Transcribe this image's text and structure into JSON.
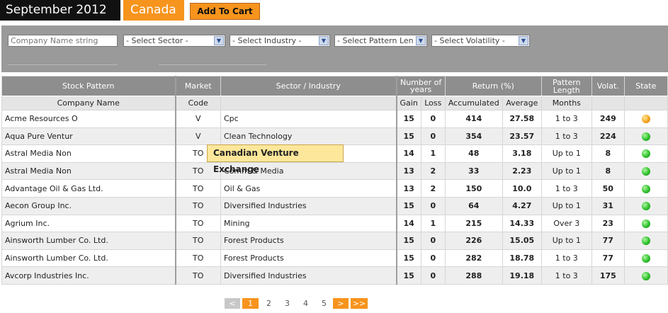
{
  "header": {
    "month": "September 2012",
    "country": "Canada",
    "add_to_cart": "Add To Cart"
  },
  "filters": {
    "company_placeholder": "Company Name string",
    "sector": "- Select Sector -",
    "industry": "- Select Industry -",
    "pattern_length": "- Select Pattern Len",
    "volatility": "- Select Volatility -"
  },
  "table": {
    "group_headers": {
      "stock_pattern": "Stock Pattern",
      "market": "Market",
      "sector_industry": "Sector / Industry",
      "number_of_years": "Number of years",
      "return": "Return (%)",
      "pattern_length": "Pattern Length",
      "volat": "Volat.",
      "state": "State"
    },
    "sub_headers": {
      "company_name": "Company Name",
      "code": "Code",
      "gain": "Gain",
      "loss": "Loss",
      "accumulated": "Accumulated",
      "average": "Average",
      "months": "Months"
    },
    "rows": [
      {
        "company": "Acme Resources O",
        "code": "V",
        "sector": "Cpc",
        "gain": "15",
        "loss": "0",
        "accumulated": "414",
        "average": "27.58",
        "length": "1 to 3",
        "volat": "249",
        "state": "orange"
      },
      {
        "company": "Aqua Pure Ventur",
        "code": "V",
        "sector": "Clean Technology",
        "gain": "15",
        "loss": "0",
        "accumulated": "354",
        "average": "23.57",
        "length": "1 to 3",
        "volat": "224",
        "state": "green"
      },
      {
        "company": "Astral Media Non",
        "code": "TO",
        "sector": "",
        "gain": "14",
        "loss": "1",
        "accumulated": "48",
        "average": "3.18",
        "length": "Up to 1",
        "volat": "8",
        "state": "green"
      },
      {
        "company": "Astral Media Non",
        "code": "TO",
        "sector": "Comm & Media",
        "gain": "13",
        "loss": "2",
        "accumulated": "33",
        "average": "2.23",
        "length": "Up to 1",
        "volat": "8",
        "state": "green"
      },
      {
        "company": "Advantage Oil & Gas Ltd.",
        "code": "TO",
        "sector": "Oil & Gas",
        "gain": "13",
        "loss": "2",
        "accumulated": "150",
        "average": "10.0",
        "length": "1 to 3",
        "volat": "50",
        "state": "green"
      },
      {
        "company": "Aecon Group Inc.",
        "code": "TO",
        "sector": "Diversified Industries",
        "gain": "15",
        "loss": "0",
        "accumulated": "64",
        "average": "4.27",
        "length": "Up to 1",
        "volat": "31",
        "state": "green"
      },
      {
        "company": "Agrium Inc.",
        "code": "TO",
        "sector": "Mining",
        "gain": "14",
        "loss": "1",
        "accumulated": "215",
        "average": "14.33",
        "length": "Over 3",
        "volat": "23",
        "state": "green"
      },
      {
        "company": "Ainsworth Lumber Co. Ltd.",
        "code": "TO",
        "sector": "Forest Products",
        "gain": "15",
        "loss": "0",
        "accumulated": "226",
        "average": "15.05",
        "length": "Up to 1",
        "volat": "77",
        "state": "green"
      },
      {
        "company": "Ainsworth Lumber Co. Ltd.",
        "code": "TO",
        "sector": "Forest Products",
        "gain": "15",
        "loss": "0",
        "accumulated": "282",
        "average": "18.78",
        "length": "1 to 3",
        "volat": "77",
        "state": "green"
      },
      {
        "company": "Avcorp Industries Inc.",
        "code": "TO",
        "sector": "Diversified Industries",
        "gain": "15",
        "loss": "0",
        "accumulated": "288",
        "average": "19.18",
        "length": "1 to 3",
        "volat": "175",
        "state": "green"
      }
    ]
  },
  "tooltip": "Canadian Venture Exchange",
  "pagination": {
    "prev": "<",
    "pages": [
      "1",
      "2",
      "3",
      "4",
      "5"
    ],
    "active": "1",
    "next": ">",
    "last": ">>"
  },
  "colors": {
    "accent": "#f7941d",
    "header_bg": "#8e8e8e",
    "filter_bg": "#9a9a9a",
    "state_green": "#2fc12c",
    "state_orange": "#f2a61c"
  }
}
